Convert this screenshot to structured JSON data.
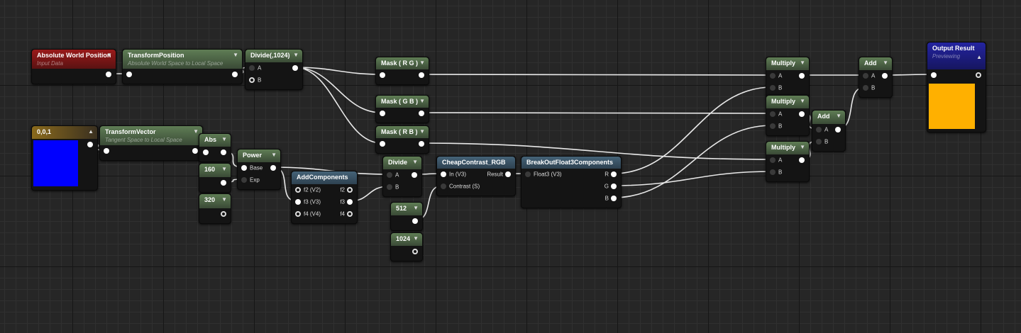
{
  "editor": "material-graph",
  "nodes": [
    {
      "title": "Absolute World Position",
      "subtitle": "Input Data",
      "header": "red",
      "arrow": "down",
      "rows": [
        {
          "out": "",
          "outState": "filled"
        }
      ]
    },
    {
      "title": "TransformPosition",
      "subtitle": "Absolute World Space to Local Space",
      "header": "green",
      "arrow": "down",
      "rows": [
        {
          "in": "",
          "inState": "filled",
          "out": "",
          "outState": "filled"
        }
      ]
    },
    {
      "title": "Divide(,1024)",
      "header": "green",
      "arrow": "down",
      "rows": [
        {
          "in": "A",
          "inState": "dim",
          "out": "",
          "outState": "filled"
        },
        {
          "in": "B",
          "inState": "hollow"
        }
      ]
    },
    {
      "title": "Mask ( R G )",
      "header": "green",
      "arrow": "down",
      "rows": [
        {
          "in": "",
          "inState": "filled",
          "out": "",
          "outState": "filled"
        }
      ]
    },
    {
      "title": "Mask ( G B )",
      "header": "green",
      "arrow": "down",
      "rows": [
        {
          "in": "",
          "inState": "filled",
          "out": "",
          "outState": "filled"
        }
      ]
    },
    {
      "title": "Mask ( R B )",
      "header": "green",
      "arrow": "down",
      "rows": [
        {
          "in": "",
          "inState": "filled",
          "out": "",
          "outState": "filled"
        }
      ]
    },
    {
      "title": "0,0,1",
      "header": "gold",
      "arrow": "up",
      "swatch": "#0000ff",
      "rows": [
        {
          "out": "",
          "outState": "filled"
        }
      ]
    },
    {
      "title": "TransformVector",
      "subtitle": "Tangent Space to Local Space",
      "header": "green",
      "arrow": "down",
      "rows": [
        {
          "in": "",
          "inState": "filled",
          "out": "",
          "outState": "filled"
        }
      ]
    },
    {
      "title": "Abs",
      "header": "green",
      "arrow": "down",
      "rows": [
        {
          "in": "",
          "inState": "filled",
          "out": "",
          "outState": "filled"
        }
      ]
    },
    {
      "title": "Power",
      "header": "green",
      "arrow": "down",
      "rows": [
        {
          "in": "Base",
          "inState": "filled",
          "out": "",
          "outState": "filled"
        },
        {
          "in": "Exp",
          "inState": "dim"
        }
      ]
    },
    {
      "title": "160",
      "header": "green",
      "arrow": "down",
      "rows": [
        {
          "out": "",
          "outState": "filled"
        }
      ]
    },
    {
      "title": "320",
      "header": "green",
      "arrow": "down",
      "rows": [
        {
          "out": "",
          "outState": "hollow"
        }
      ]
    },
    {
      "title": "AddComponents",
      "header": "steel",
      "rows": [
        {
          "in": "f2 (V2)",
          "inState": "hollow",
          "out": "f2",
          "outState": "hollow"
        },
        {
          "in": "f3 (V3)",
          "inState": "filled",
          "out": "f3",
          "outState": "filled"
        },
        {
          "in": "f4 (V4)",
          "inState": "hollow",
          "out": "f4",
          "outState": "hollow"
        }
      ]
    },
    {
      "title": "Divide",
      "header": "green",
      "arrow": "down",
      "rows": [
        {
          "in": "A",
          "inState": "dim",
          "out": "",
          "outState": "filled"
        },
        {
          "in": "B",
          "inState": "dim"
        }
      ]
    },
    {
      "title": "512",
      "header": "green",
      "arrow": "down",
      "rows": [
        {
          "out": "",
          "outState": "filled"
        }
      ]
    },
    {
      "title": "1024",
      "header": "green",
      "arrow": "down",
      "rows": [
        {
          "out": "",
          "outState": "hollow"
        }
      ]
    },
    {
      "title": "CheapContrast_RGB",
      "header": "steel",
      "rows": [
        {
          "in": "In (V3)",
          "inState": "filled",
          "out": "Result",
          "outState": "filled"
        },
        {
          "in": "Contrast (S)",
          "inState": "dim"
        }
      ]
    },
    {
      "title": "BreakOutFloat3Components",
      "header": "steel",
      "rows": [
        {
          "in": "Float3 (V3)",
          "inState": "dim",
          "out": "R",
          "outState": "filled"
        },
        {
          "out": "G",
          "outState": "filled"
        },
        {
          "out": "B",
          "outState": "filled"
        }
      ]
    },
    {
      "title": "Multiply",
      "header": "green",
      "arrow": "down",
      "rows": [
        {
          "in": "A",
          "inState": "dim",
          "out": "",
          "outState": "filled"
        },
        {
          "in": "B",
          "inState": "dim"
        }
      ]
    },
    {
      "title": "Multiply",
      "header": "green",
      "arrow": "down",
      "rows": [
        {
          "in": "A",
          "inState": "dim",
          "out": "",
          "outState": "filled"
        },
        {
          "in": "B",
          "inState": "dim"
        }
      ]
    },
    {
      "title": "Add",
      "header": "green",
      "arrow": "down",
      "rows": [
        {
          "in": "A",
          "inState": "dim",
          "out": "",
          "outState": "filled"
        },
        {
          "in": "B",
          "inState": "dim"
        }
      ]
    },
    {
      "title": "Multiply",
      "header": "green",
      "arrow": "down",
      "rows": [
        {
          "in": "A",
          "inState": "dim",
          "out": "",
          "outState": "filled"
        },
        {
          "in": "B",
          "inState": "dim"
        }
      ]
    },
    {
      "title": "Add",
      "header": "green",
      "arrow": "down",
      "rows": [
        {
          "in": "A",
          "inState": "dim",
          "out": "",
          "outState": "filled"
        },
        {
          "in": "B",
          "inState": "dim"
        }
      ]
    },
    {
      "title": "Output Result",
      "subtitle": "Previewing",
      "header": "navy",
      "arrow": "up",
      "swatch": "#ffb000",
      "rows": [
        {
          "in": "",
          "inState": "filled",
          "out": "",
          "outState": "hollow"
        }
      ]
    }
  ],
  "icons": {
    "down": "▼",
    "up": "▲"
  }
}
